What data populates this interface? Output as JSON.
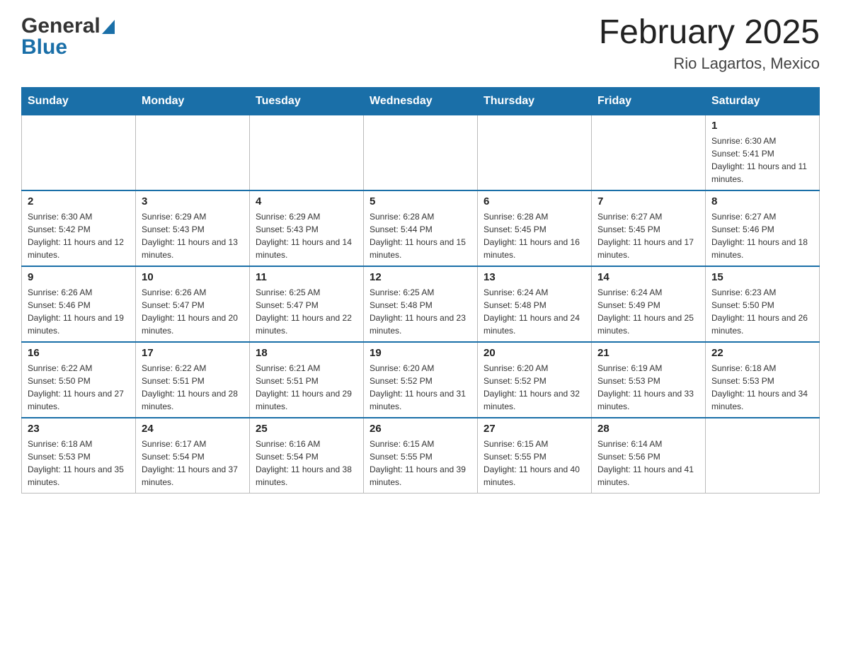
{
  "header": {
    "logo_general": "General",
    "logo_blue": "Blue",
    "title": "February 2025",
    "subtitle": "Rio Lagartos, Mexico"
  },
  "days_of_week": [
    "Sunday",
    "Monday",
    "Tuesday",
    "Wednesday",
    "Thursday",
    "Friday",
    "Saturday"
  ],
  "weeks": [
    {
      "days": [
        {
          "number": "",
          "info": ""
        },
        {
          "number": "",
          "info": ""
        },
        {
          "number": "",
          "info": ""
        },
        {
          "number": "",
          "info": ""
        },
        {
          "number": "",
          "info": ""
        },
        {
          "number": "",
          "info": ""
        },
        {
          "number": "1",
          "info": "Sunrise: 6:30 AM\nSunset: 5:41 PM\nDaylight: 11 hours and 11 minutes."
        }
      ]
    },
    {
      "days": [
        {
          "number": "2",
          "info": "Sunrise: 6:30 AM\nSunset: 5:42 PM\nDaylight: 11 hours and 12 minutes."
        },
        {
          "number": "3",
          "info": "Sunrise: 6:29 AM\nSunset: 5:43 PM\nDaylight: 11 hours and 13 minutes."
        },
        {
          "number": "4",
          "info": "Sunrise: 6:29 AM\nSunset: 5:43 PM\nDaylight: 11 hours and 14 minutes."
        },
        {
          "number": "5",
          "info": "Sunrise: 6:28 AM\nSunset: 5:44 PM\nDaylight: 11 hours and 15 minutes."
        },
        {
          "number": "6",
          "info": "Sunrise: 6:28 AM\nSunset: 5:45 PM\nDaylight: 11 hours and 16 minutes."
        },
        {
          "number": "7",
          "info": "Sunrise: 6:27 AM\nSunset: 5:45 PM\nDaylight: 11 hours and 17 minutes."
        },
        {
          "number": "8",
          "info": "Sunrise: 6:27 AM\nSunset: 5:46 PM\nDaylight: 11 hours and 18 minutes."
        }
      ]
    },
    {
      "days": [
        {
          "number": "9",
          "info": "Sunrise: 6:26 AM\nSunset: 5:46 PM\nDaylight: 11 hours and 19 minutes."
        },
        {
          "number": "10",
          "info": "Sunrise: 6:26 AM\nSunset: 5:47 PM\nDaylight: 11 hours and 20 minutes."
        },
        {
          "number": "11",
          "info": "Sunrise: 6:25 AM\nSunset: 5:47 PM\nDaylight: 11 hours and 22 minutes."
        },
        {
          "number": "12",
          "info": "Sunrise: 6:25 AM\nSunset: 5:48 PM\nDaylight: 11 hours and 23 minutes."
        },
        {
          "number": "13",
          "info": "Sunrise: 6:24 AM\nSunset: 5:48 PM\nDaylight: 11 hours and 24 minutes."
        },
        {
          "number": "14",
          "info": "Sunrise: 6:24 AM\nSunset: 5:49 PM\nDaylight: 11 hours and 25 minutes."
        },
        {
          "number": "15",
          "info": "Sunrise: 6:23 AM\nSunset: 5:50 PM\nDaylight: 11 hours and 26 minutes."
        }
      ]
    },
    {
      "days": [
        {
          "number": "16",
          "info": "Sunrise: 6:22 AM\nSunset: 5:50 PM\nDaylight: 11 hours and 27 minutes."
        },
        {
          "number": "17",
          "info": "Sunrise: 6:22 AM\nSunset: 5:51 PM\nDaylight: 11 hours and 28 minutes."
        },
        {
          "number": "18",
          "info": "Sunrise: 6:21 AM\nSunset: 5:51 PM\nDaylight: 11 hours and 29 minutes."
        },
        {
          "number": "19",
          "info": "Sunrise: 6:20 AM\nSunset: 5:52 PM\nDaylight: 11 hours and 31 minutes."
        },
        {
          "number": "20",
          "info": "Sunrise: 6:20 AM\nSunset: 5:52 PM\nDaylight: 11 hours and 32 minutes."
        },
        {
          "number": "21",
          "info": "Sunrise: 6:19 AM\nSunset: 5:53 PM\nDaylight: 11 hours and 33 minutes."
        },
        {
          "number": "22",
          "info": "Sunrise: 6:18 AM\nSunset: 5:53 PM\nDaylight: 11 hours and 34 minutes."
        }
      ]
    },
    {
      "days": [
        {
          "number": "23",
          "info": "Sunrise: 6:18 AM\nSunset: 5:53 PM\nDaylight: 11 hours and 35 minutes."
        },
        {
          "number": "24",
          "info": "Sunrise: 6:17 AM\nSunset: 5:54 PM\nDaylight: 11 hours and 37 minutes."
        },
        {
          "number": "25",
          "info": "Sunrise: 6:16 AM\nSunset: 5:54 PM\nDaylight: 11 hours and 38 minutes."
        },
        {
          "number": "26",
          "info": "Sunrise: 6:15 AM\nSunset: 5:55 PM\nDaylight: 11 hours and 39 minutes."
        },
        {
          "number": "27",
          "info": "Sunrise: 6:15 AM\nSunset: 5:55 PM\nDaylight: 11 hours and 40 minutes."
        },
        {
          "number": "28",
          "info": "Sunrise: 6:14 AM\nSunset: 5:56 PM\nDaylight: 11 hours and 41 minutes."
        },
        {
          "number": "",
          "info": ""
        }
      ]
    }
  ]
}
